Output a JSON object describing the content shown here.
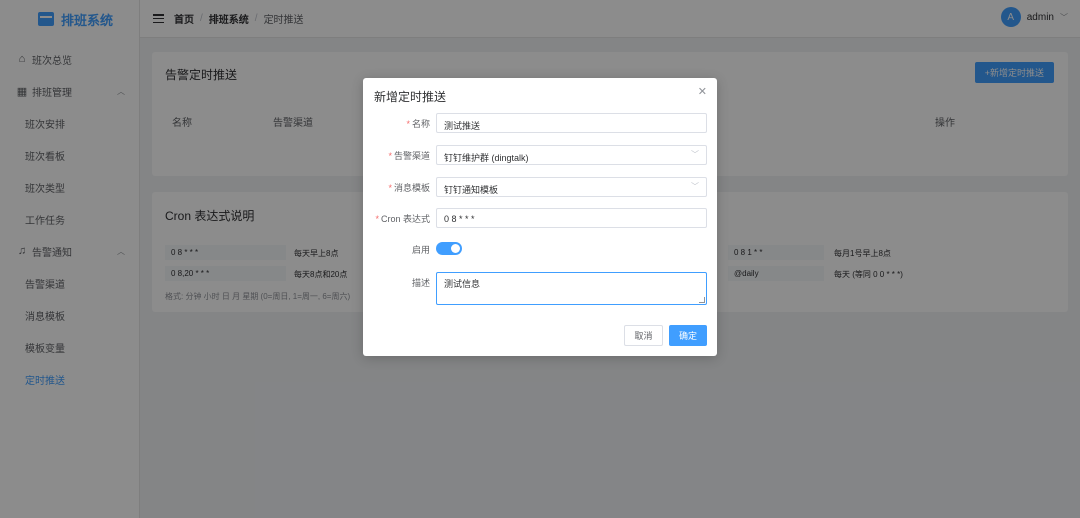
{
  "app": {
    "title": "排班系统"
  },
  "sidebar": {
    "items": [
      {
        "label": "班次总览"
      },
      {
        "label": "排班管理",
        "children": [
          "班次安排",
          "班次看板",
          "班次类型",
          "工作任务"
        ]
      },
      {
        "label": "告警通知",
        "children": [
          "告警渠道",
          "消息模板",
          "模板变量",
          "定时推送"
        ]
      }
    ]
  },
  "header": {
    "breadcrumb": [
      "首页",
      "排班系统",
      "定时推送"
    ],
    "user": {
      "avatar": "A",
      "name": "admin"
    }
  },
  "main": {
    "push_card": {
      "title": "告警定时推送",
      "add_button": "+新增定时推送",
      "columns": [
        "名称",
        "告警渠道",
        "操作"
      ]
    },
    "cron_card": {
      "title": "Cron 表达式说明",
      "rows": [
        [
          "0 8 * * *",
          "每天早上8点",
          "0 8 1 * *",
          "每月1号早上8点"
        ],
        [
          "0 8,20 * * *",
          "每天8点和20点",
          "@daily",
          "每天 (等同 0 0 * * *)"
        ]
      ],
      "note": "格式: 分钟 小时 日 月 星期 (0=周日, 1=周一, 6=周六)"
    }
  },
  "dialog": {
    "title": "新增定时推送",
    "close_icon": "close-icon",
    "fields": {
      "name": {
        "label": "名称",
        "value": "测试推送"
      },
      "channel": {
        "label": "告警渠道",
        "value": "钉钉维护群 (dingtalk)"
      },
      "template": {
        "label": "消息模板",
        "value": "钉钉通知模板"
      },
      "cron": {
        "label": "Cron 表达式",
        "value": "0 8 * * *"
      },
      "enabled": {
        "label": "启用",
        "on": true
      },
      "desc": {
        "label": "描述",
        "value": "测试信息"
      }
    },
    "buttons": {
      "cancel": "取消",
      "ok": "确定"
    }
  },
  "colors": {
    "primary": "#409eff",
    "required": "#f56c6c"
  }
}
